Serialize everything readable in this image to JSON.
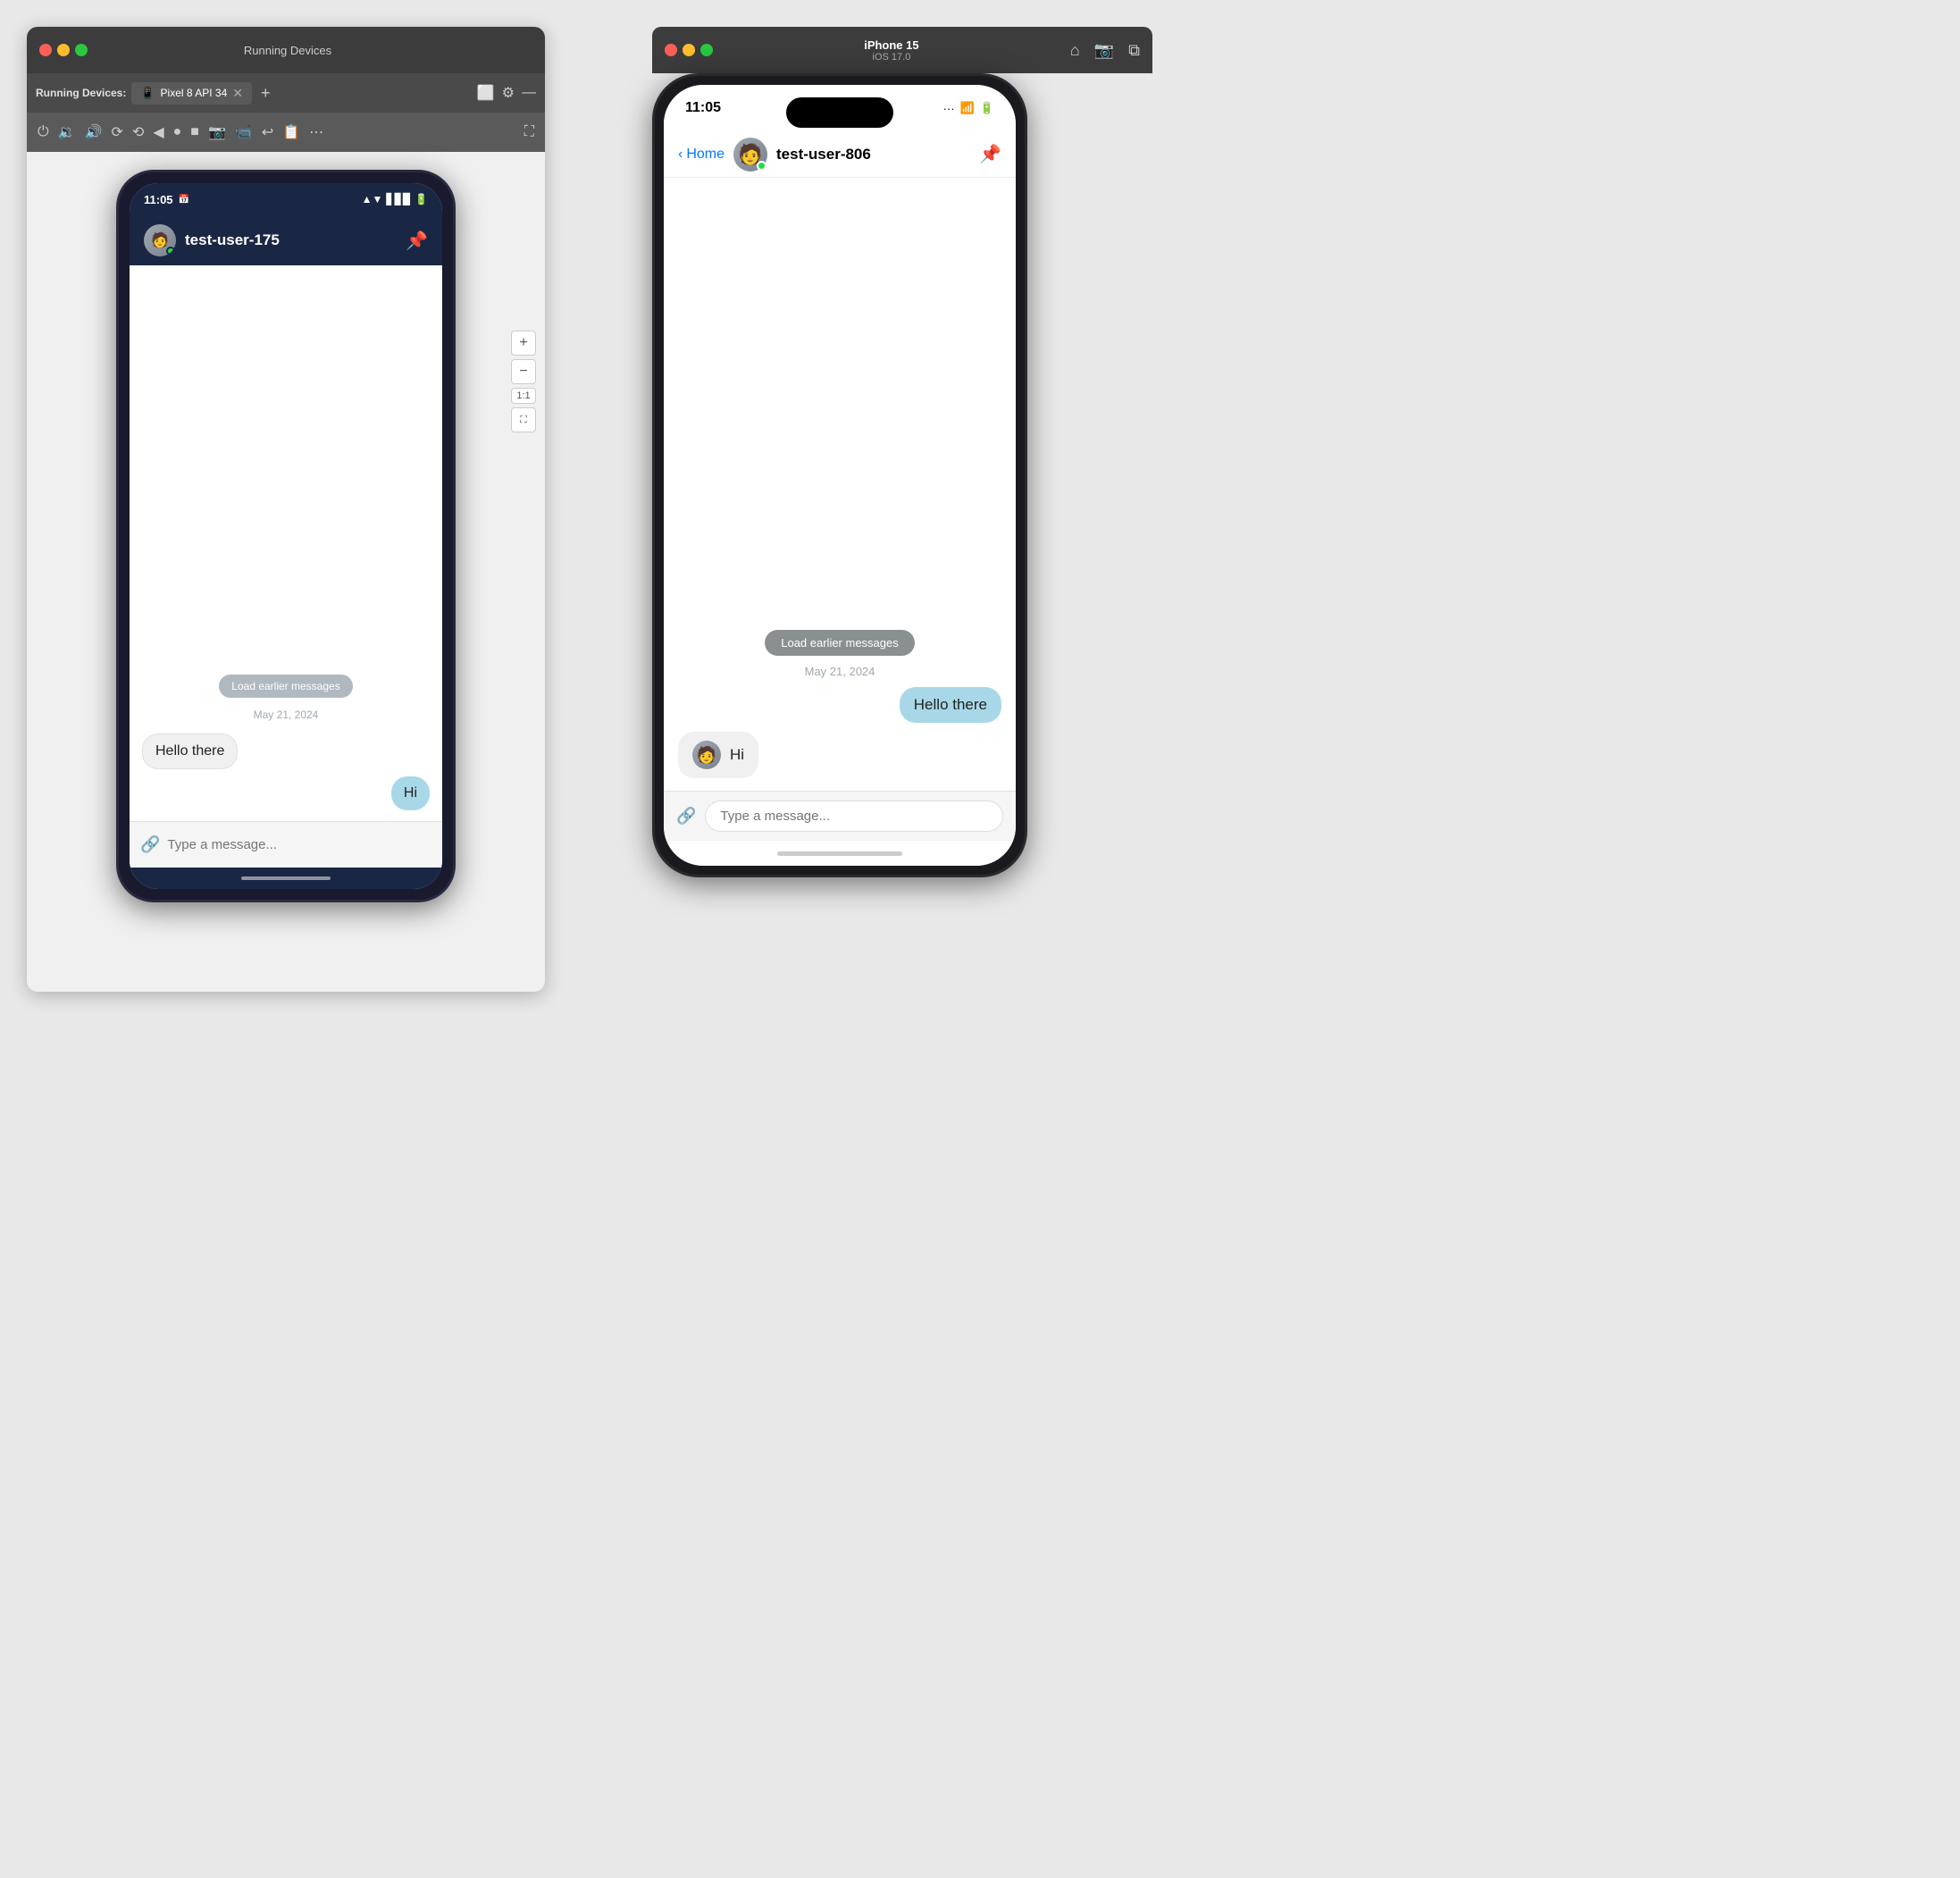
{
  "android_panel": {
    "titlebar": {
      "title": "Running Devices",
      "tab_label": "Pixel 8 API 34"
    },
    "device_label": "Running Devices:",
    "phone": {
      "status_bar": {
        "time": "11:05",
        "notification_icon": "📅"
      },
      "chat_header": {
        "username": "test-user-175"
      },
      "messages": {
        "load_earlier": "Load earlier messages",
        "date": "May 21, 2024",
        "received": "Hello there",
        "sent": "Hi"
      },
      "input_placeholder": "Type a message..."
    },
    "zoom": {
      "plus": "+",
      "minus": "−",
      "level": "1:1"
    }
  },
  "ios_panel": {
    "toolbar": {
      "device_name": "iPhone 15",
      "device_sub": "iOS 17.0"
    },
    "phone": {
      "status_bar": {
        "time": "11:05"
      },
      "nav": {
        "back_label": "Home",
        "username": "test-user-806"
      },
      "messages": {
        "load_earlier": "Load earlier messages",
        "date": "May 21, 2024",
        "sent": "Hello there",
        "received": "Hi"
      },
      "input_placeholder": "Type a message..."
    }
  }
}
